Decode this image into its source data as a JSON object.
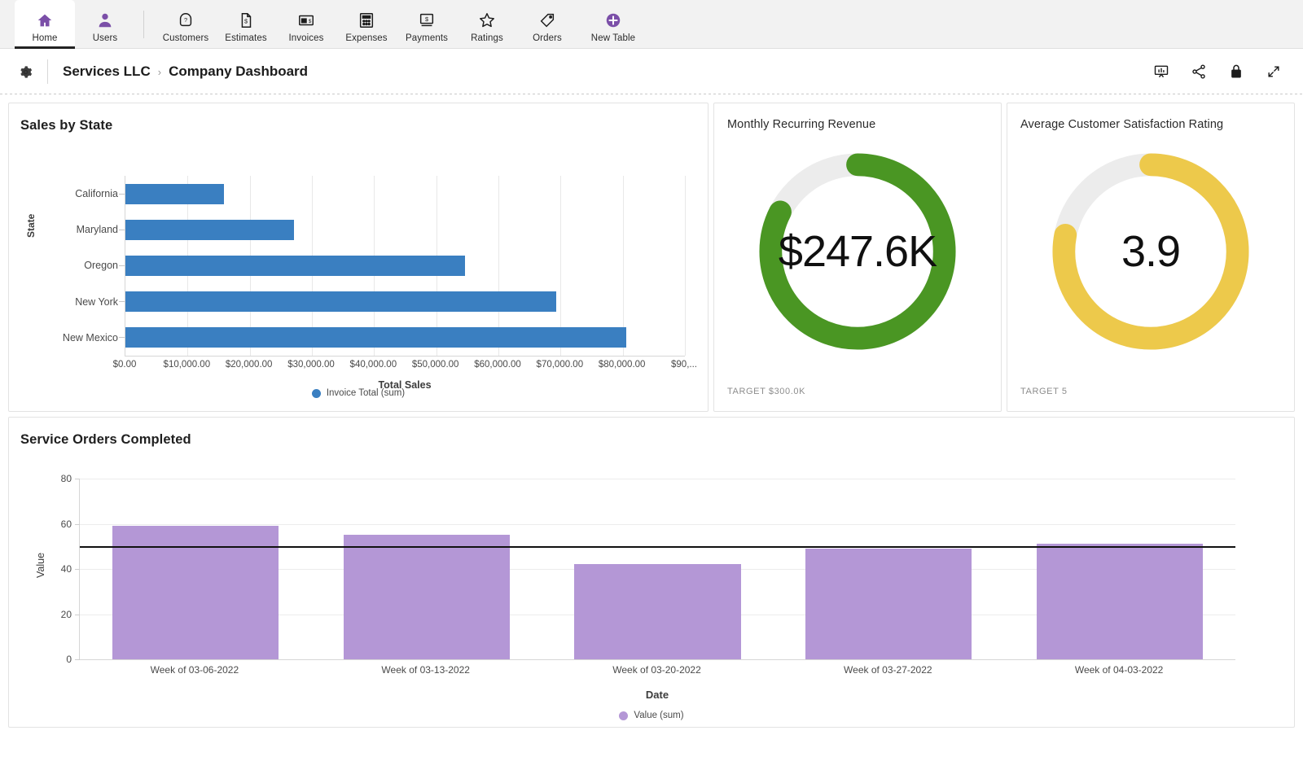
{
  "nav": {
    "items": [
      {
        "label": "Home",
        "icon": "home-icon",
        "active": true
      },
      {
        "label": "Users",
        "icon": "user-icon",
        "active": false
      },
      {
        "label": "Customers",
        "icon": "customer-badge-icon",
        "active": false
      },
      {
        "label": "Estimates",
        "icon": "document-dollar-icon",
        "active": false
      },
      {
        "label": "Invoices",
        "icon": "invoice-icon",
        "active": false
      },
      {
        "label": "Expenses",
        "icon": "calculator-icon",
        "active": false
      },
      {
        "label": "Payments",
        "icon": "payment-icon",
        "active": false
      },
      {
        "label": "Ratings",
        "icon": "star-icon",
        "active": false
      },
      {
        "label": "Orders",
        "icon": "tag-icon",
        "active": false
      },
      {
        "label": "New Table",
        "icon": "plus-circle-icon",
        "active": false
      }
    ]
  },
  "header": {
    "gear_icon": "gear-icon",
    "org": "Services LLC",
    "separator": "›",
    "page": "Company Dashboard",
    "actions": [
      {
        "name": "presentation-icon",
        "label": "Present"
      },
      {
        "name": "share-icon",
        "label": "Share"
      },
      {
        "name": "lock-icon",
        "label": "Lock"
      },
      {
        "name": "expand-icon",
        "label": "Expand"
      }
    ]
  },
  "colors": {
    "bar_blue": "#3a7fc1",
    "bar_purple": "#b497d6",
    "gauge_green": "#4a9623",
    "gauge_yellow": "#edc94b",
    "gauge_track": "#ececec",
    "accent_purple": "#7b4fa8",
    "refline": "#111111"
  },
  "cards": {
    "sales": {
      "title": "Sales by State"
    },
    "mrr": {
      "title": "Monthly Recurring Revenue",
      "value": "$247.6K",
      "target_label": "TARGET $300.0K"
    },
    "csat": {
      "title": "Average Customer Satisfaction Rating",
      "value": "3.9",
      "target_label": "TARGET 5"
    },
    "orders": {
      "title": "Service Orders Completed"
    }
  },
  "chart_data": [
    {
      "type": "bar",
      "orientation": "horizontal",
      "title": "Sales by State",
      "categories": [
        "California",
        "Maryland",
        "Oregon",
        "New York",
        "New Mexico"
      ],
      "values": [
        15800,
        27100,
        54600,
        69300,
        80600
      ],
      "series": [
        {
          "name": "Invoice Total (sum)",
          "values": [
            15800,
            27100,
            54600,
            69300,
            80600
          ],
          "color": "#3a7fc1"
        }
      ],
      "xlabel": "Total Sales",
      "ylabel": "State",
      "xlim": [
        0,
        90000
      ],
      "xticks": [
        "$0.00",
        "$10,000.00",
        "$20,000.00",
        "$30,000.00",
        "$40,000.00",
        "$50,000.00",
        "$60,000.00",
        "$70,000.00",
        "$80,000.00",
        "$90,..."
      ],
      "xtick_values": [
        0,
        10000,
        20000,
        30000,
        40000,
        50000,
        60000,
        70000,
        80000,
        90000
      ],
      "legend": [
        {
          "label": "Invoice Total (sum)",
          "color": "#3a7fc1"
        }
      ],
      "legend_position": "bottom",
      "grid": true
    },
    {
      "type": "gauge",
      "title": "Monthly Recurring Revenue",
      "value": 247600,
      "value_label": "$247.6K",
      "target": 300000,
      "target_label": "TARGET $300.0K",
      "percent": 82.5,
      "color": "#4a9623",
      "track_color": "#ececec"
    },
    {
      "type": "gauge",
      "title": "Average Customer Satisfaction Rating",
      "value": 3.9,
      "value_label": "3.9",
      "target": 5,
      "target_label": "TARGET 5",
      "percent": 78,
      "color": "#edc94b",
      "track_color": "#ececec"
    },
    {
      "type": "bar",
      "orientation": "vertical",
      "title": "Service Orders Completed",
      "categories": [
        "Week of 03-06-2022",
        "Week of 03-13-2022",
        "Week of 03-20-2022",
        "Week of 03-27-2022",
        "Week of 04-03-2022"
      ],
      "values": [
        59,
        55,
        42,
        49,
        51
      ],
      "series": [
        {
          "name": "Value (sum)",
          "values": [
            59,
            55,
            42,
            49,
            51
          ],
          "color": "#b497d6"
        }
      ],
      "xlabel": "Date",
      "ylabel": "Value",
      "ylim": [
        0,
        80
      ],
      "yticks": [
        0,
        20,
        40,
        60,
        80
      ],
      "reference_line": {
        "value": 50,
        "color": "#111111"
      },
      "legend": [
        {
          "label": "Value (sum)",
          "color": "#b497d6"
        }
      ],
      "legend_position": "bottom",
      "grid": true
    }
  ]
}
